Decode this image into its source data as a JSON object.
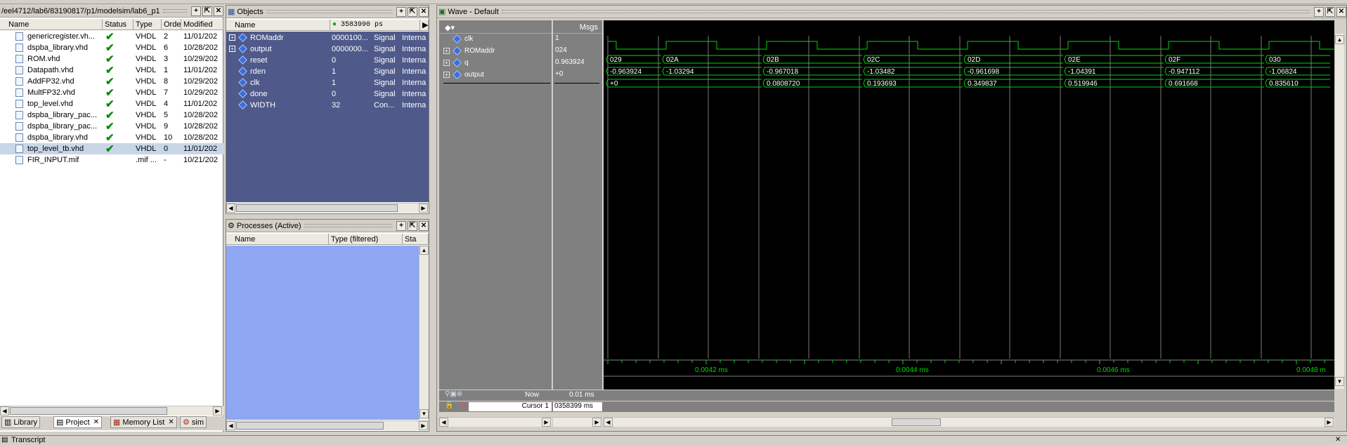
{
  "library": {
    "path": "/eel4712/lab6/83190817/p1/modelsim/lab6_p1",
    "columns": [
      "Name",
      "Status",
      "Type",
      "Order",
      "Modified"
    ],
    "files": [
      {
        "name": "genericregister.vh...",
        "type": "VHDL",
        "order": "2",
        "modified": "11/01/202"
      },
      {
        "name": "dspba_library.vhd",
        "type": "VHDL",
        "order": "6",
        "modified": "10/28/202"
      },
      {
        "name": "ROM.vhd",
        "type": "VHDL",
        "order": "3",
        "modified": "10/29/202"
      },
      {
        "name": "Datapath.vhd",
        "type": "VHDL",
        "order": "1",
        "modified": "11/01/202"
      },
      {
        "name": "AddFP32.vhd",
        "type": "VHDL",
        "order": "8",
        "modified": "10/29/202"
      },
      {
        "name": "MultFP32.vhd",
        "type": "VHDL",
        "order": "7",
        "modified": "10/29/202"
      },
      {
        "name": "top_level.vhd",
        "type": "VHDL",
        "order": "4",
        "modified": "11/01/202"
      },
      {
        "name": "dspba_library_pac...",
        "type": "VHDL",
        "order": "5",
        "modified": "10/28/202"
      },
      {
        "name": "dspba_library_pac...",
        "type": "VHDL",
        "order": "9",
        "modified": "10/28/202"
      },
      {
        "name": "dspba_library.vhd",
        "type": "VHDL",
        "order": "10",
        "modified": "10/28/202"
      },
      {
        "name": "top_level_tb.vhd",
        "type": "VHDL",
        "order": "0",
        "modified": "11/01/202"
      },
      {
        "name": "FIR_INPUT.mif",
        "type": ".mif ...",
        "order": "-",
        "modified": "10/21/202"
      }
    ],
    "tabs": [
      "Library",
      "Project",
      "Memory List",
      "sim"
    ]
  },
  "objects": {
    "title": "Objects",
    "columns": [
      "Name",
      "3583990 ps"
    ],
    "rows": [
      {
        "name": "ROMaddr",
        "value": "0000100...",
        "kind": "Signal",
        "mode": "Interna",
        "expand": true
      },
      {
        "name": "output",
        "value": "0000000...",
        "kind": "Signal",
        "mode": "Interna",
        "expand": true
      },
      {
        "name": "reset",
        "value": "0",
        "kind": "Signal",
        "mode": "Interna",
        "expand": false
      },
      {
        "name": "rden",
        "value": "1",
        "kind": "Signal",
        "mode": "Interna",
        "expand": false
      },
      {
        "name": "clk",
        "value": "1",
        "kind": "Signal",
        "mode": "Interna",
        "expand": false
      },
      {
        "name": "done",
        "value": "0",
        "kind": "Signal",
        "mode": "Interna",
        "expand": false
      },
      {
        "name": "WIDTH",
        "value": "32",
        "kind": "Con...",
        "mode": "Interna",
        "expand": false
      }
    ]
  },
  "processes": {
    "title": "Processes (Active)",
    "columns": [
      "Name",
      "Type (filtered)",
      "Sta"
    ]
  },
  "wave": {
    "title": "Wave - Default",
    "msgs_header": "Msgs",
    "signals": [
      {
        "name": "clk",
        "value": "1",
        "expand": false
      },
      {
        "name": "ROMaddr",
        "value": "024",
        "expand": true
      },
      {
        "name": "q",
        "value": "0.963924",
        "expand": true
      },
      {
        "name": "output",
        "value": "+0",
        "expand": true
      }
    ],
    "romaddr_values": [
      "029",
      "02A",
      "02B",
      "02C",
      "02D",
      "02E",
      "02F",
      "030"
    ],
    "q_values": [
      "-0.963924",
      "-1.03294",
      "-0.967018",
      "-1.03482",
      "-0.961698",
      "-1.04391",
      "-0.947112",
      "-1.06824"
    ],
    "output_values": [
      "+0",
      "0.0808720",
      "0.193693",
      "0.349837",
      "0.519946",
      "0.691668",
      "0.835610"
    ],
    "now_label": "Now",
    "now_value": "0.01 ms",
    "cursor_label": "Cursor 1",
    "cursor_value": "0358399 ms",
    "time_ticks": [
      "0.0042 ms",
      "0.0044 ms",
      "0.0046 ms",
      "0.0048 m"
    ]
  },
  "transcript": {
    "title": "Transcript"
  },
  "colors": {
    "wave_bg": "#000000",
    "signal_green": "#00d800",
    "objects_bg": "#4f5a8a",
    "processes_bg": "#8fa6f2"
  }
}
